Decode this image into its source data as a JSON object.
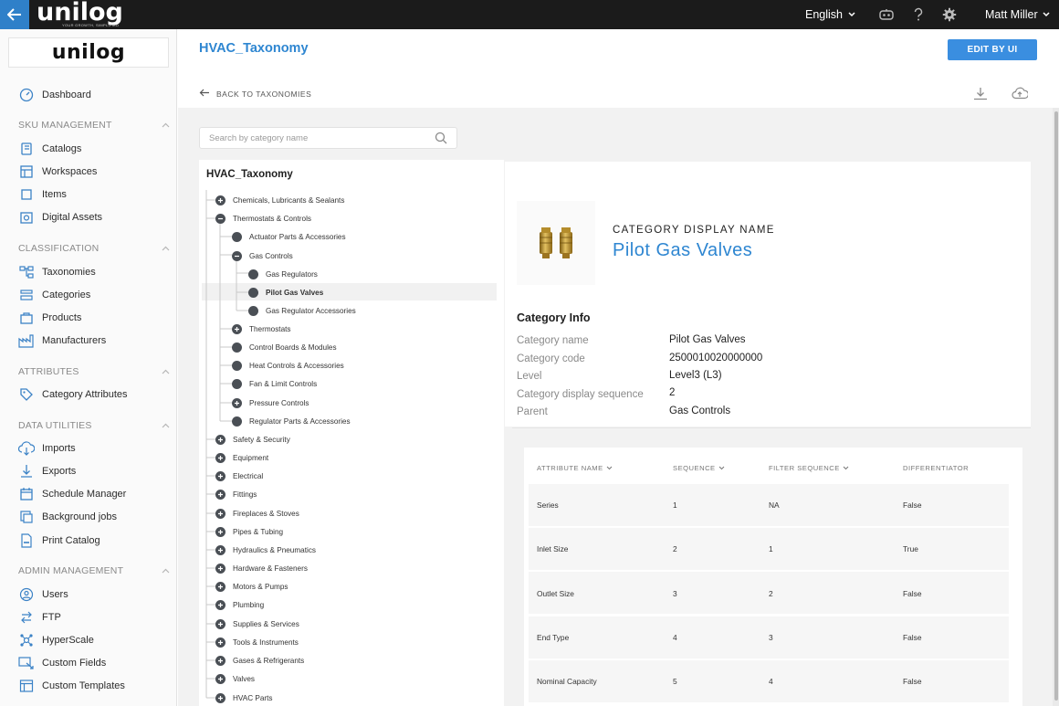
{
  "topbar": {
    "brand": "unilog",
    "brand_tagline": "YOUR GROWTH, SIMPLIFIED",
    "language": "English",
    "user_name": "Matt Miller",
    "icons": [
      "back-arrow-icon",
      "robot-icon",
      "help-icon",
      "gear-icon"
    ]
  },
  "sidebar": {
    "logo": "unilog",
    "dashboard": "Dashboard",
    "sections": {
      "sku": "SKU MANAGEMENT",
      "classification": "CLASSIFICATION",
      "attributes": "ATTRIBUTES",
      "data_utilities": "DATA UTILITIES",
      "admin": "ADMIN MANAGEMENT"
    },
    "items": {
      "catalogs": "Catalogs",
      "workspaces": "Workspaces",
      "items": "Items",
      "digital_assets": "Digital Assets",
      "taxonomies": "Taxonomies",
      "categories": "Categories",
      "products": "Products",
      "manufacturers": "Manufacturers",
      "category_attributes": "Category Attributes",
      "imports": "Imports",
      "exports": "Exports",
      "schedule_manager": "Schedule Manager",
      "background_jobs": "Background jobs",
      "print_catalog": "Print Catalog",
      "users": "Users",
      "ftp": "FTP",
      "hyperscale": "HyperScale",
      "custom_fields": "Custom Fields",
      "custom_templates": "Custom Templates"
    }
  },
  "page": {
    "title": "HVAC_Taxonomy",
    "edit_button": "EDIT BY UI",
    "back_link": "BACK TO TAXONOMIES",
    "search_placeholder": "Search by category name"
  },
  "tree": {
    "root": "HVAC_Taxonomy",
    "nodes": {
      "chemicals": "Chemicals, Lubricants & Sealants",
      "thermostats_controls": "Thermostats & Controls",
      "actuator_parts": "Actuator Parts & Accessories",
      "gas_controls": "Gas Controls",
      "gas_regulators": "Gas Regulators",
      "pilot_gas_valves": "Pilot Gas Valves",
      "gas_regulator_accessories": "Gas Regulator Accessories",
      "thermostats": "Thermostats",
      "control_boards": "Control Boards & Modules",
      "heat_controls": "Heat Controls & Accessories",
      "fan_limit": "Fan & Limit Controls",
      "pressure_controls": "Pressure Controls",
      "regulator_parts": "Regulator Parts & Accessories",
      "safety": "Safety & Security",
      "equipment": "Equipment",
      "electrical": "Electrical",
      "fittings": "Fittings",
      "fireplaces": "Fireplaces & Stoves",
      "pipes": "Pipes & Tubing",
      "hydraulics": "Hydraulics & Pneumatics",
      "hardware": "Hardware & Fasteners",
      "motors": "Motors & Pumps",
      "plumbing": "Plumbing",
      "supplies": "Supplies & Services",
      "tools": "Tools & Instruments",
      "gases": "Gases & Refrigerants",
      "valves": "Valves",
      "hvac_parts": "HVAC Parts"
    }
  },
  "detail": {
    "display_name_label": "CATEGORY DISPLAY NAME",
    "display_name": "Pilot Gas Valves",
    "info_title": "Category Info",
    "labels": {
      "name": "Category name",
      "code": "Category code",
      "level": "Level",
      "sequence": "Category display sequence",
      "parent": "Parent"
    },
    "values": {
      "name": "Pilot Gas Valves",
      "code": "2500010020000000",
      "level": "Level3 (L3)",
      "sequence": "2",
      "parent": "Gas Controls"
    }
  },
  "attributes": {
    "headers": {
      "name": "ATTRIBUTE NAME",
      "sequence": "SEQUENCE",
      "filter_sequence": "FILTER SEQUENCE",
      "differentiator": "DIFFERENTIATOR"
    },
    "rows": [
      {
        "name": "Series",
        "sequence": "1",
        "filter": "NA",
        "diff": "False"
      },
      {
        "name": "Inlet Size",
        "sequence": "2",
        "filter": "1",
        "diff": "True"
      },
      {
        "name": "Outlet Size",
        "sequence": "3",
        "filter": "2",
        "diff": "False"
      },
      {
        "name": "End Type",
        "sequence": "4",
        "filter": "3",
        "diff": "False"
      },
      {
        "name": "Nominal Capacity",
        "sequence": "5",
        "filter": "4",
        "diff": "False"
      }
    ]
  },
  "colors": {
    "accent": "#2e86d1",
    "button": "#3a8ee0",
    "topbar": "#1b1b1b",
    "back_button": "#2f80c9"
  }
}
